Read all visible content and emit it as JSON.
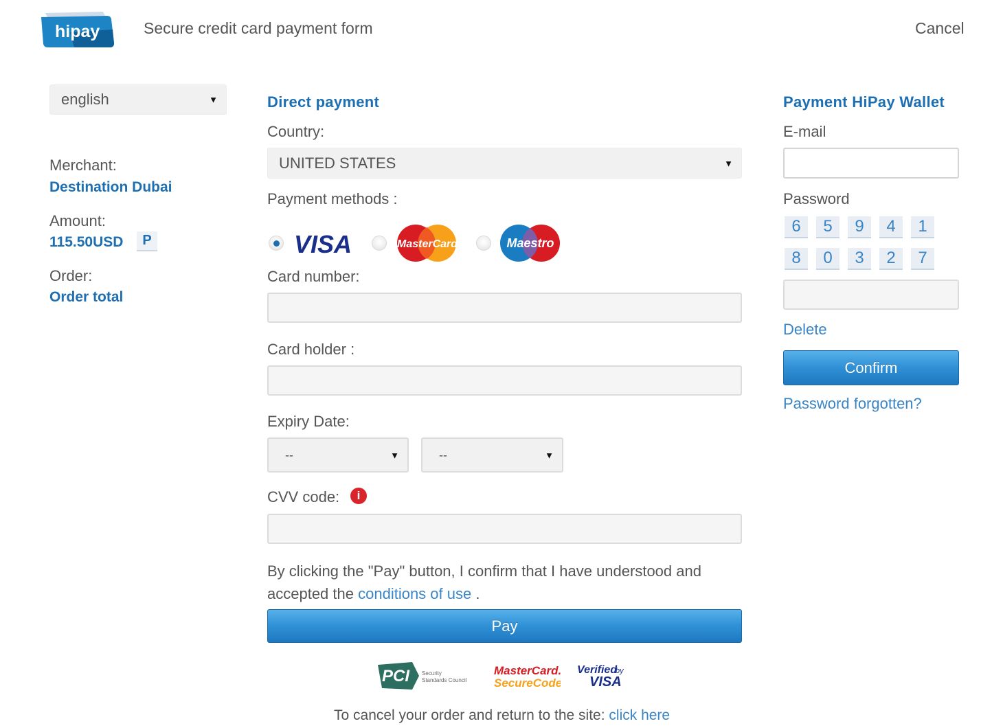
{
  "header": {
    "logo_text": "hipay",
    "title": "Secure credit card payment form",
    "cancel_label": "Cancel"
  },
  "language_select": {
    "value": "english"
  },
  "order_info": {
    "merchant_label": "Merchant:",
    "merchant_value": "Destination Dubai",
    "amount_label": "Amount:",
    "amount_value": "115.50USD",
    "amount_badge_icon": "p-letter-icon",
    "order_label": "Order:",
    "order_value": "Order total"
  },
  "direct_payment": {
    "title": "Direct payment",
    "country_label": "Country:",
    "country_value": "UNITED STATES",
    "payment_methods_label": "Payment methods :",
    "methods": [
      {
        "name": "VISA",
        "selected": true
      },
      {
        "name": "MasterCard",
        "selected": false
      },
      {
        "name": "Maestro",
        "selected": false
      }
    ],
    "card_number_label": "Card number:",
    "card_holder_label": "Card holder :",
    "expiry_label": "Expiry Date:",
    "expiry_month": "--",
    "expiry_year": "--",
    "cvv_label": "CVV code:",
    "terms_text": "By clicking the \"Pay\" button, I confirm that I have understood and accepted the",
    "terms_link": "conditions of use",
    "terms_end": ".",
    "pay_label": "Pay"
  },
  "wallet": {
    "title": "Payment HiPay Wallet",
    "email_label": "E-mail",
    "password_label": "Password",
    "keypad": [
      [
        "6",
        "5",
        "9",
        "4",
        "1"
      ],
      [
        "8",
        "0",
        "3",
        "2",
        "7"
      ]
    ],
    "delete_label": "Delete",
    "confirm_label": "Confirm",
    "forgot_label": "Password forgotten?"
  },
  "trust_badges": {
    "pci_text": "PCI",
    "pci_sub1": "Security",
    "pci_sub2": "Standards Council",
    "mc_line1": "MasterCard.",
    "mc_line2": "SecureCode.",
    "vbv_line1": "Verified",
    "vbv_by": "by",
    "vbv_line2": "VISA"
  },
  "footer": {
    "cancel_text": "To cancel your order and return to the site:",
    "cancel_link": "click here"
  },
  "colors": {
    "accent": "#1e6fb2",
    "link": "#3a85c5",
    "button": "#2f90d6",
    "alert_red": "#d9252a"
  }
}
